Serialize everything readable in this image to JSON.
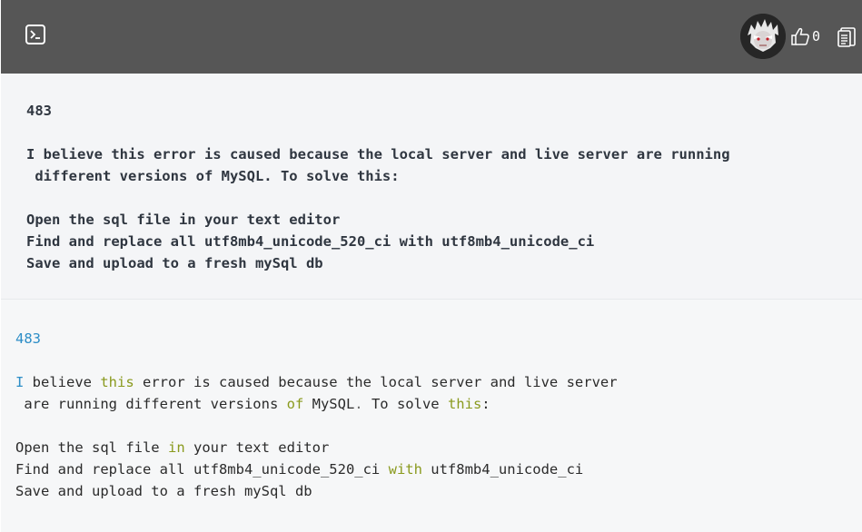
{
  "header": {
    "terminal_icon": "terminal-icon",
    "avatar_icon": "user-avatar",
    "like_icon": "thumbs-up-icon",
    "like_count": "0",
    "copy_icon": "clipboard-icon",
    "background": "#565656"
  },
  "rendered": {
    "lines": [
      "483",
      "",
      "I believe this error is caused because the local server and live server are running",
      " different versions of MySQL. To solve this:",
      "",
      "Open the sql file in your text editor",
      "Find and replace all utf8mb4_unicode_520_ci with utf8mb4_unicode_ci",
      "Save and upload to a fresh mySql db"
    ]
  },
  "source": {
    "l1_num": "483",
    "l3_a": "I",
    "l3_b": " believe ",
    "l3_c": "this",
    "l3_d": " error is caused because the local server and live server",
    "l4_a": " are running different versions ",
    "l4_b": "of",
    "l4_c": " MySQL",
    "l4_d": ".",
    "l4_e": " To solve ",
    "l4_f": "this",
    "l4_g": ":",
    "l6_a": "Open the sql file ",
    "l6_b": "in",
    "l6_c": " your text editor",
    "l7_a": "Find and replace all utf8mb4_unicode_520_ci ",
    "l7_b": "with",
    "l7_c": " utf8mb4_unicode_ci",
    "l8_a": "Save and upload to a fresh mySql db"
  },
  "colors": {
    "number": "#2d8ec7",
    "keyword": "#8a9a1e",
    "text": "#2b2b2b"
  }
}
